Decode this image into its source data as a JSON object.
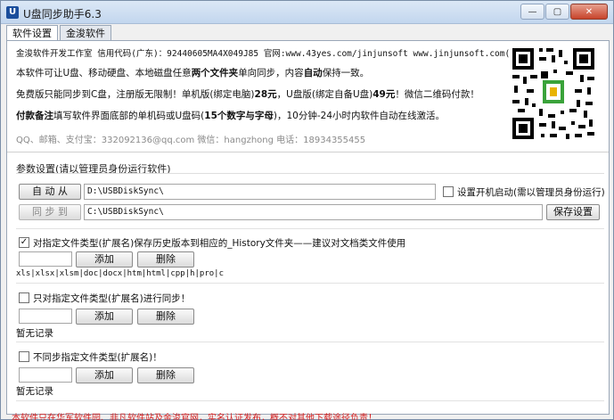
{
  "window": {
    "title": "U盘同步助手6.3",
    "app_icon": "U"
  },
  "titlebar_buttons": {
    "minimize": "—",
    "maximize": "▢",
    "close": "✕"
  },
  "tabs": [
    {
      "label": "软件设置"
    },
    {
      "label": "金浚软件"
    }
  ],
  "info": {
    "line1": "金浚软件开发工作室 信用代码(广东)：92440605MA4X049J85 官网:www.43yes.com/jinjunsoft  www.jinjunsoft.com(在建)",
    "line2_a": "本软件可让U盘、移动硬盘、本地磁盘任意",
    "line2_b": "两个文件夹",
    "line2_c": "单向同步，内容",
    "line2_d": "自动",
    "line2_e": "保持一致。",
    "line3_a": "免费版只能同步到C盘，注册版无限制！单机版(绑定电脑)",
    "line3_b": "28元",
    "line3_c": "，U盘版(绑定自备U盘)",
    "line3_d": "49元",
    "line3_e": "！微信二维码付款！",
    "line4_a": "付款备注",
    "line4_b": "填写软件界面底部的单机码或U盘码(",
    "line4_c": "15个数字与字母",
    "line4_d": ")，10分钟-24小时内软件自动在线激活。",
    "line5": "QQ、邮箱、支付宝：332092136@qq.com      微信：hangzhong      电话：18934355455"
  },
  "params": {
    "section_title": "参数设置(请以管理员身份运行软件)",
    "from_button": "自 动 从",
    "from_path": "D:\\USBDiskSync\\",
    "autostart_label": "设置开机启动(需以管理员身份运行)",
    "to_button": "同 步 到",
    "to_path": "C:\\USBDiskSync\\",
    "save_button": "保存设置"
  },
  "groups": {
    "history_label": "对指定文件类型(扩展名)保存历史版本到相应的_History文件夹——建议对文档类文件使用",
    "history_ext": "xls|xlsx|xlsm|doc|docx|htm|html|cpp|h|pro|c",
    "only_label": "只对指定文件类型(扩展名)进行同步！",
    "exclude_label": "不同步指定文件类型(扩展名)！",
    "add_label": "添加",
    "delete_label": "删除",
    "empty_label": "暂无记录"
  },
  "footer": "本软件只在华军软件园、非凡软件站及金浚官网，实名认证发布，概不对其他下载途径负责！",
  "colors": {
    "footer_red": "#d62020",
    "info_gray": "#8a8a8a",
    "title_bg": "#c2d6ee"
  }
}
